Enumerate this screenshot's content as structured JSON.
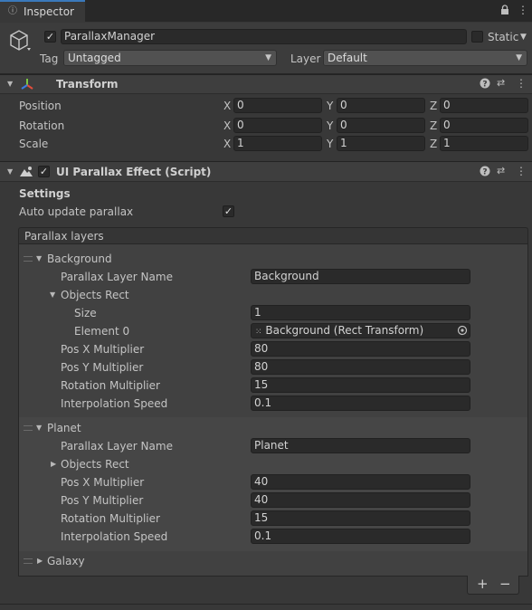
{
  "tab": {
    "title": "Inspector"
  },
  "object": {
    "active": true,
    "name": "ParallaxManager",
    "static_label": "Static",
    "tag_label": "Tag",
    "tag_value": "Untagged",
    "layer_label": "Layer",
    "layer_value": "Default"
  },
  "transform": {
    "title": "Transform",
    "position_label": "Position",
    "rotation_label": "Rotation",
    "scale_label": "Scale",
    "axis_x": "X",
    "axis_y": "Y",
    "axis_z": "Z",
    "position": {
      "x": "0",
      "y": "0",
      "z": "0"
    },
    "rotation": {
      "x": "0",
      "y": "0",
      "z": "0"
    },
    "scale": {
      "x": "1",
      "y": "1",
      "z": "1"
    }
  },
  "script": {
    "title": "UI Parallax Effect (Script)",
    "enabled": true,
    "settings_label": "Settings",
    "auto_update_label": "Auto update parallax",
    "auto_update": true,
    "list_title": "Parallax layers",
    "field_labels": {
      "name": "Parallax Layer Name",
      "objects_rect": "Objects Rect",
      "size": "Size",
      "pos_x": "Pos X Multiplier",
      "pos_y": "Pos Y Multiplier",
      "rotation": "Rotation Multiplier",
      "interp": "Interpolation Speed"
    },
    "layers": [
      {
        "label": "Background",
        "name": "Background",
        "objects_rect": {
          "size": "1",
          "element0_label": "Element 0",
          "element0_value": "Background (Rect Transform)"
        },
        "pos_x": "80",
        "pos_y": "80",
        "rotation": "15",
        "interp": "0.1"
      },
      {
        "label": "Planet",
        "name": "Planet",
        "pos_x": "40",
        "pos_y": "40",
        "rotation": "15",
        "interp": "0.1"
      },
      {
        "label": "Galaxy"
      }
    ],
    "add_label": "+",
    "remove_label": "−"
  },
  "icons": {
    "lock": "lock-icon",
    "menu": "kebab-menu-icon",
    "cube": "gameobject-cube-icon",
    "transform": "transform-axes-icon",
    "help": "help-icon",
    "presets": "presets-icon",
    "script": "script-icon",
    "picker": "object-picker-icon"
  }
}
